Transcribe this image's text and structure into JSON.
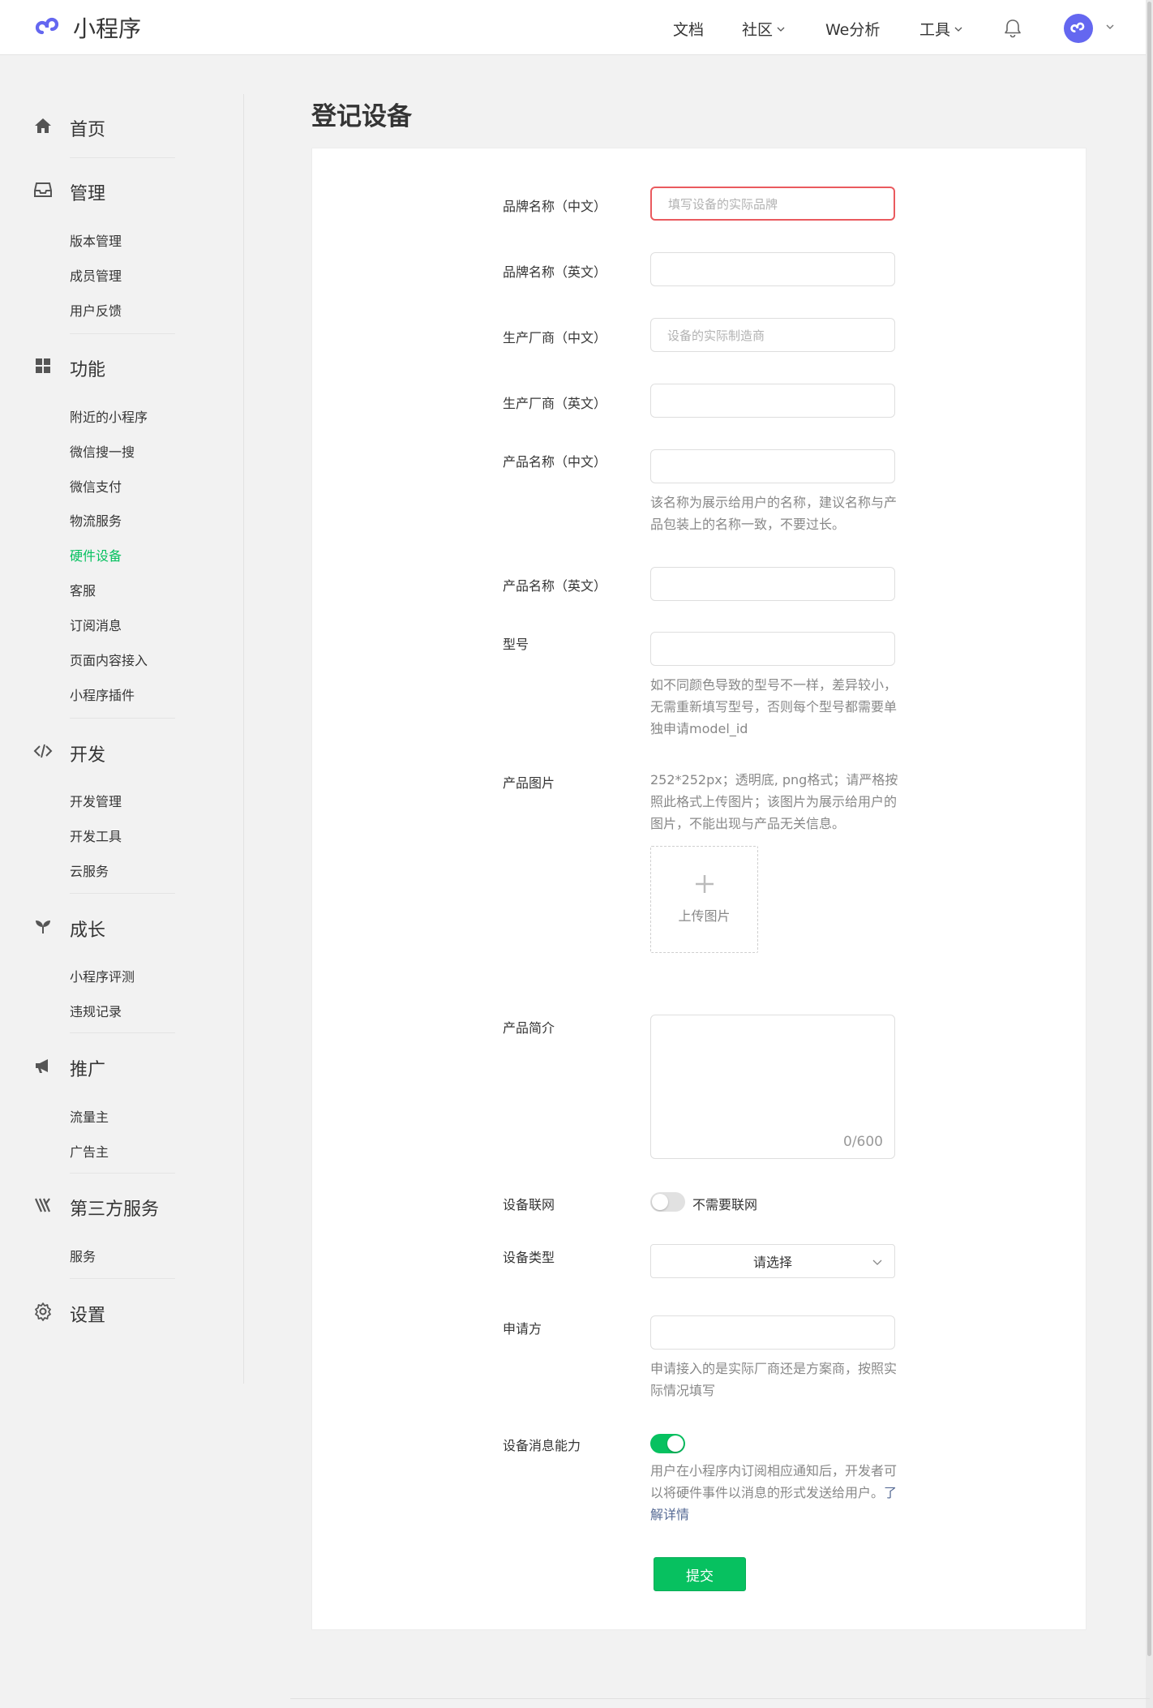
{
  "header": {
    "app_name": "小程序",
    "nav": [
      {
        "label": "文档"
      },
      {
        "label": "社区"
      },
      {
        "label": "We分析"
      },
      {
        "label": "工具"
      }
    ]
  },
  "sidebar": {
    "sections": [
      {
        "label": "首页",
        "icon": "home-icon",
        "items": []
      },
      {
        "label": "管理",
        "icon": "inbox-icon",
        "items": [
          "版本管理",
          "成员管理",
          "用户反馈"
        ]
      },
      {
        "label": "功能",
        "icon": "grid-icon",
        "items": [
          "附近的小程序",
          "微信搜一搜",
          "微信支付",
          "物流服务",
          "硬件设备",
          "客服",
          "订阅消息",
          "页面内容接入",
          "小程序插件"
        ]
      },
      {
        "label": "开发",
        "icon": "code-icon",
        "items": [
          "开发管理",
          "开发工具",
          "云服务"
        ]
      },
      {
        "label": "成长",
        "icon": "sprout-icon",
        "items": [
          "小程序评测",
          "违规记录"
        ]
      },
      {
        "label": "推广",
        "icon": "megaphone-icon",
        "items": [
          "流量主",
          "广告主"
        ]
      },
      {
        "label": "第三方服务",
        "icon": "third-party-icon",
        "items": [
          "服务"
        ]
      },
      {
        "label": "设置",
        "icon": "gear-icon",
        "items": []
      }
    ],
    "active_item": "硬件设备",
    "active_color": "#07c160"
  },
  "page": {
    "title": "登记设备"
  },
  "form": {
    "brand_cn": {
      "label": "品牌名称（中文）",
      "placeholder": "填写设备的实际品牌",
      "value": ""
    },
    "brand_en": {
      "label": "品牌名称（英文）",
      "value": ""
    },
    "maker_cn": {
      "label": "生产厂商（中文）",
      "placeholder": "设备的实际制造商",
      "value": ""
    },
    "maker_en": {
      "label": "生产厂商（英文）",
      "value": ""
    },
    "product_cn": {
      "label": "产品名称（中文）",
      "tip": "该名称为展示给用户的名称，建议名称与产品包装上的名称一致，不要过长。",
      "value": ""
    },
    "product_en": {
      "label": "产品名称（英文）",
      "value": ""
    },
    "model": {
      "label": "型号",
      "tip": "如不同颜色导致的型号不一样，差异较小，无需重新填写型号，否则每个型号都需要单独申请model_id",
      "value": ""
    },
    "image": {
      "label": "产品图片",
      "tip": "252*252px；透明底, png格式；请严格按照此格式上传图片；该图片为展示给用户的图片，不能出现与产品无关信息。",
      "upload_label": "上传图片"
    },
    "intro": {
      "label": "产品简介",
      "counter": "0/600",
      "value": ""
    },
    "network": {
      "label": "设备联网",
      "toggle_on": false,
      "toggle_text": "不需要联网"
    },
    "device_type": {
      "label": "设备类型",
      "selected": "请选择"
    },
    "applicant": {
      "label": "申请方",
      "tip": "申请接入的是实际厂商还是方案商，按照实际情况填写",
      "value": ""
    },
    "message": {
      "label": "设备消息能力",
      "toggle_on": true,
      "tip": "用户在小程序内订阅相应通知后，开发者可以将硬件事件以消息的形式发送给用户。",
      "link": "了解详情"
    },
    "submit_label": "提交"
  },
  "colors": {
    "accent": "#07c160",
    "error_border": "#ea5a5e",
    "link": "#576b95",
    "avatar": "#6467f0"
  }
}
